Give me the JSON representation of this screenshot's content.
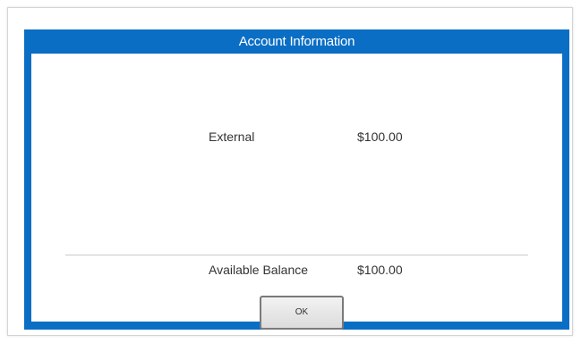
{
  "dialog": {
    "title": "Account Information",
    "accent_color": "#0a6ec5",
    "rows": [
      {
        "label": "External",
        "value": "$100.00"
      }
    ],
    "summary": {
      "label": "Available Balance",
      "value": "$100.00"
    },
    "ok_label": "OK"
  }
}
